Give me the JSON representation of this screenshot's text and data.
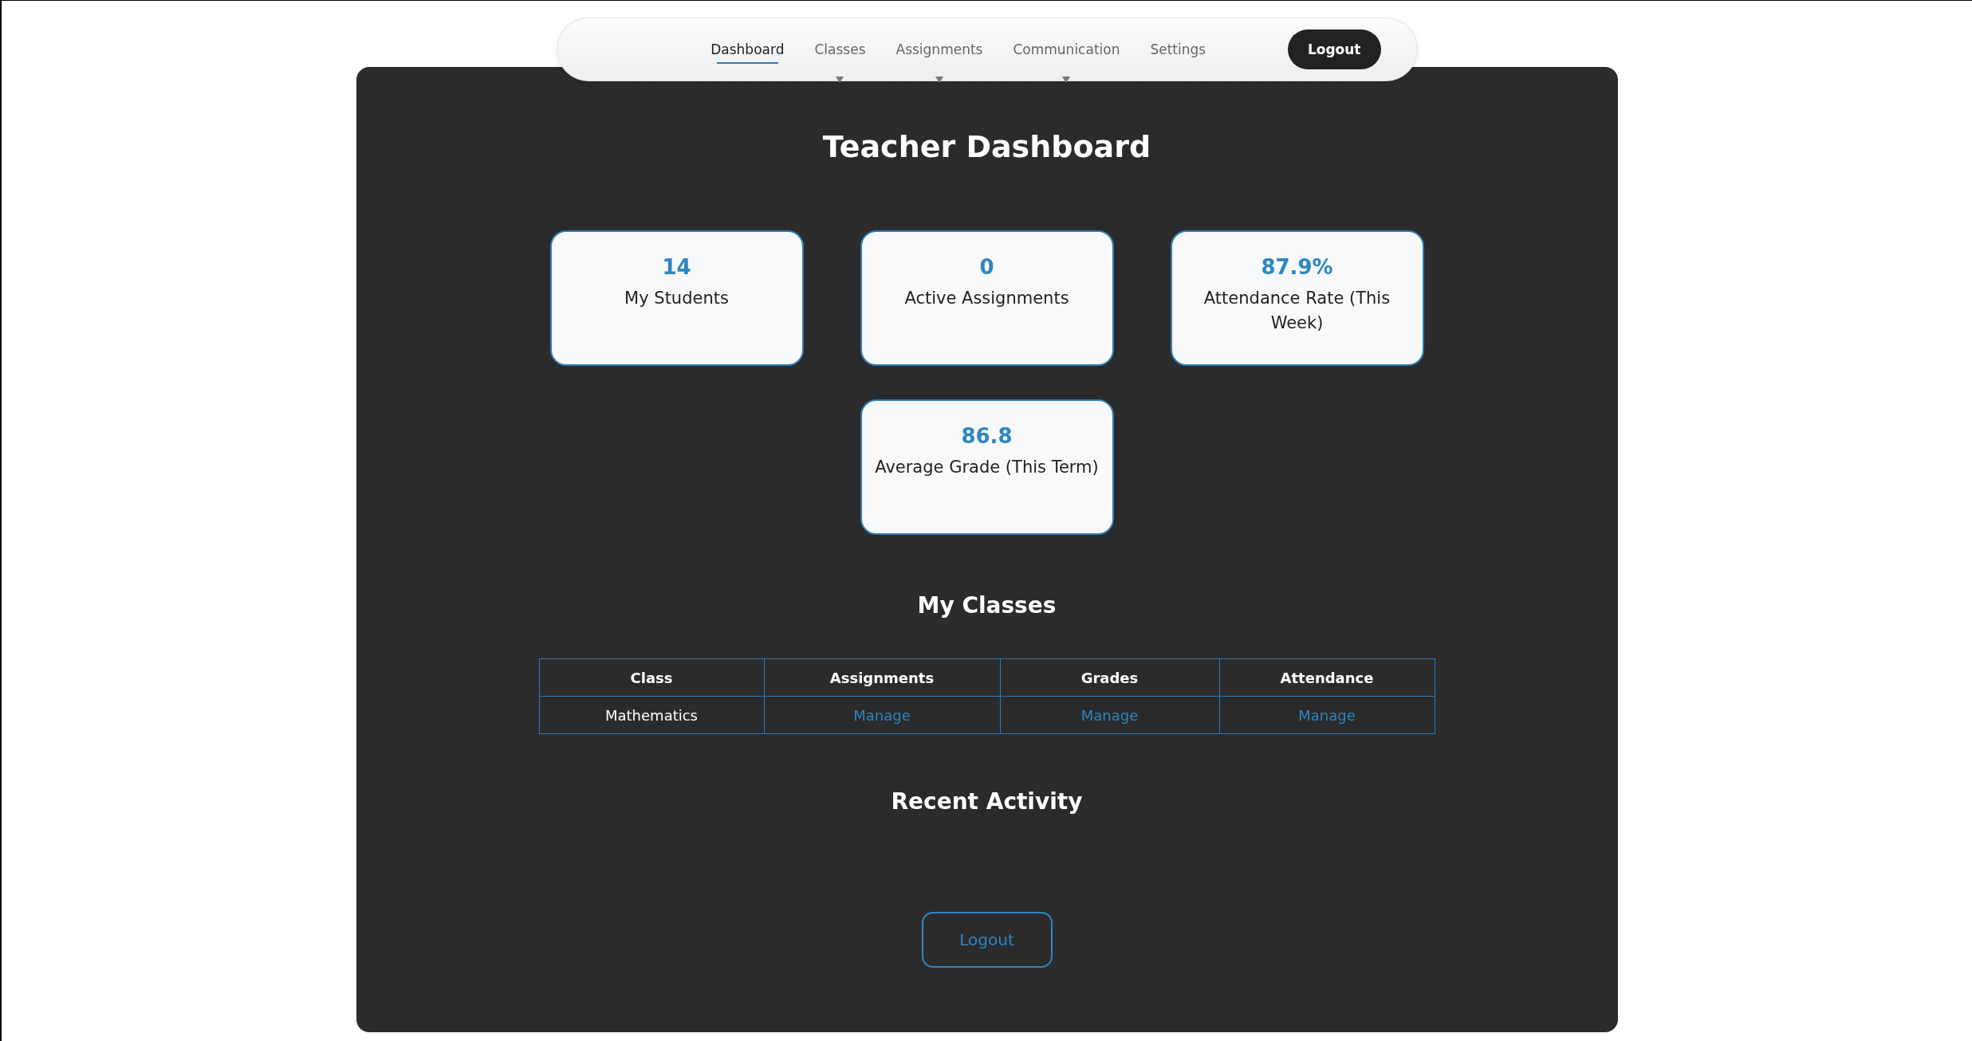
{
  "nav": {
    "items": [
      {
        "label": "Dashboard",
        "selected": true,
        "dropdown": false
      },
      {
        "label": "Classes",
        "selected": false,
        "dropdown": true
      },
      {
        "label": "Assignments",
        "selected": false,
        "dropdown": true
      },
      {
        "label": "Communication",
        "selected": false,
        "dropdown": true
      },
      {
        "label": "Settings",
        "selected": false,
        "dropdown": false
      }
    ],
    "logout": "Logout"
  },
  "title": "Teacher Dashboard",
  "stats": [
    {
      "value": "14",
      "label": "My Students"
    },
    {
      "value": "0",
      "label": "Active Assignments"
    },
    {
      "value": "87.9%",
      "label": "Attendance Rate (This Week)"
    },
    {
      "value": "86.8",
      "label": "Average Grade (This Term)"
    }
  ],
  "classes": {
    "heading": "My Classes",
    "columns": [
      "Class",
      "Assignments",
      "Grades",
      "Attendance"
    ],
    "rows": [
      [
        {
          "text": "Mathematics",
          "kind": "text"
        },
        {
          "text": "Manage",
          "kind": "link"
        },
        {
          "text": "Manage",
          "kind": "link"
        },
        {
          "text": "Manage",
          "kind": "link"
        }
      ]
    ]
  },
  "activity": {
    "heading": "Recent Activity"
  },
  "footer_button": "Logout"
}
